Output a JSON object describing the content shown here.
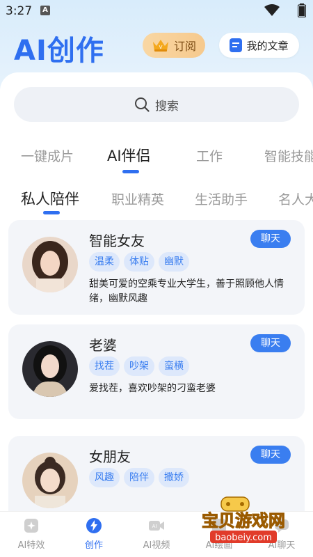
{
  "status_bar": {
    "time": "3:27",
    "indicator": "A"
  },
  "header": {
    "title": "AI创作",
    "subscribe_label": "订阅",
    "my_articles_label": "我的文章"
  },
  "search": {
    "label": "搜索"
  },
  "category_tabs": [
    {
      "label": "一键成片",
      "active": false
    },
    {
      "label": "AI伴侣",
      "active": true
    },
    {
      "label": "工作",
      "active": false
    },
    {
      "label": "智能技能",
      "active": false
    }
  ],
  "sub_tabs": [
    {
      "label": "私人陪伴",
      "active": true
    },
    {
      "label": "职业精英",
      "active": false
    },
    {
      "label": "生活助手",
      "active": false
    },
    {
      "label": "名人大",
      "active": false
    }
  ],
  "cards": [
    {
      "name": "智能女友",
      "chat_label": "聊天",
      "tags": [
        "温柔",
        "体贴",
        "幽默"
      ],
      "description": "甜美可爱的空乘专业大学生，善于照顾他人情绪，幽默风趣"
    },
    {
      "name": "老婆",
      "chat_label": "聊天",
      "tags": [
        "找茬",
        "吵架",
        "蛮横"
      ],
      "description": "爱找茬，喜欢吵架的刁蛮老婆"
    },
    {
      "name": "女朋友",
      "chat_label": "聊天",
      "tags": [
        "风趣",
        "陪伴",
        "撒娇"
      ],
      "description": ""
    }
  ],
  "bottom_nav": [
    {
      "label": "AI特效",
      "icon": "sparkle-icon",
      "active": false
    },
    {
      "label": "创作",
      "icon": "lightning-icon",
      "active": true
    },
    {
      "label": "AI视频",
      "icon": "video-icon",
      "active": false
    },
    {
      "label": "AI绘画",
      "icon": "paint-icon",
      "active": false
    },
    {
      "label": "AI聊天",
      "icon": "chat-icon",
      "active": false
    }
  ],
  "watermark": {
    "title": "宝贝游戏网",
    "url": "baobeiy.com"
  },
  "colors": {
    "accent": "#2f6ff0",
    "chat_button": "#3a7ef0",
    "tag_bg": "#dde8fb",
    "card_bg": "#f3f5f9",
    "subscribe_bg": "#f6c98d"
  }
}
